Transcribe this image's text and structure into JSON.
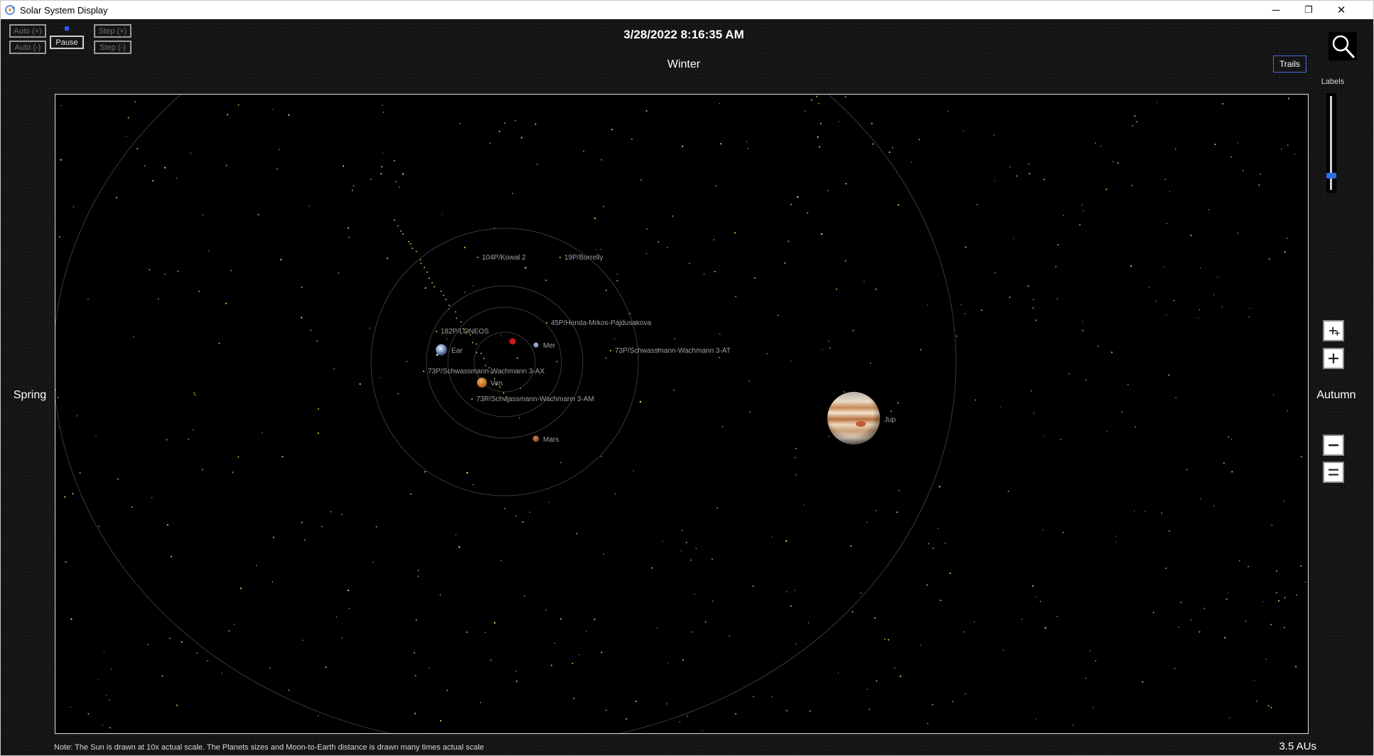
{
  "window": {
    "title": "Solar System Display",
    "controls": {
      "minimize": "─",
      "restore": "❐",
      "close": "✕"
    }
  },
  "toolbar": {
    "auto_plus": "Auto (+)",
    "auto_minus": "Auto (-)",
    "pause": "Pause",
    "step_plus": "Step (+)",
    "step_minus": "Step (-)"
  },
  "datetime": "3/28/2022 8:16:35 AM",
  "seasons": {
    "top": "Winter",
    "left": "Spring",
    "right": "Autumn"
  },
  "trails_label": "Trails",
  "labels_slider": {
    "title": "Labels",
    "value": 0.85
  },
  "icons": {
    "search": "search-icon",
    "zoom_in_fast": "zoom-in-double-icon",
    "zoom_in": "zoom-in-icon",
    "zoom_out": "zoom-out-icon",
    "zoom_out_fast": "zoom-out-double-icon"
  },
  "colors": {
    "sun": "#d01818",
    "mercury": "#8fa0d8",
    "venus": "#d08830",
    "earth": "#8aa4c8",
    "mars": "#b36a3a",
    "jupiter": "#d9b48a",
    "comet": "#a8e84a",
    "orbit": "#3a3a3a",
    "label": "#a0a0a0",
    "trails_border": "#3f6fd6"
  },
  "bodies": [
    {
      "name": "Sun",
      "label": ""
    },
    {
      "name": "Mercury",
      "label": "Mer"
    },
    {
      "name": "Venus",
      "label": "Ven"
    },
    {
      "name": "Earth",
      "label": "Ear"
    },
    {
      "name": "Mars",
      "label": "Mars"
    },
    {
      "name": "Jupiter",
      "label": "Jup"
    }
  ],
  "comets": [
    "104P/Kowal 2",
    "19P/Borrelly",
    "45P/Honda-Mrkos-Pajdusakova",
    "182P/LONEOS",
    "73P/Schwassmann-Wachmann 3-AT",
    "73P/Schwassmann-Wachmann 3-AX",
    "73P/Schwassmann-Wachmann 3-AM"
  ],
  "footnote": "Note: The Sun is drawn at 10x actual scale. The Planets sizes and Moon-to-Earth distance is drawn many times actual scale",
  "scale": "3.5 AUs"
}
